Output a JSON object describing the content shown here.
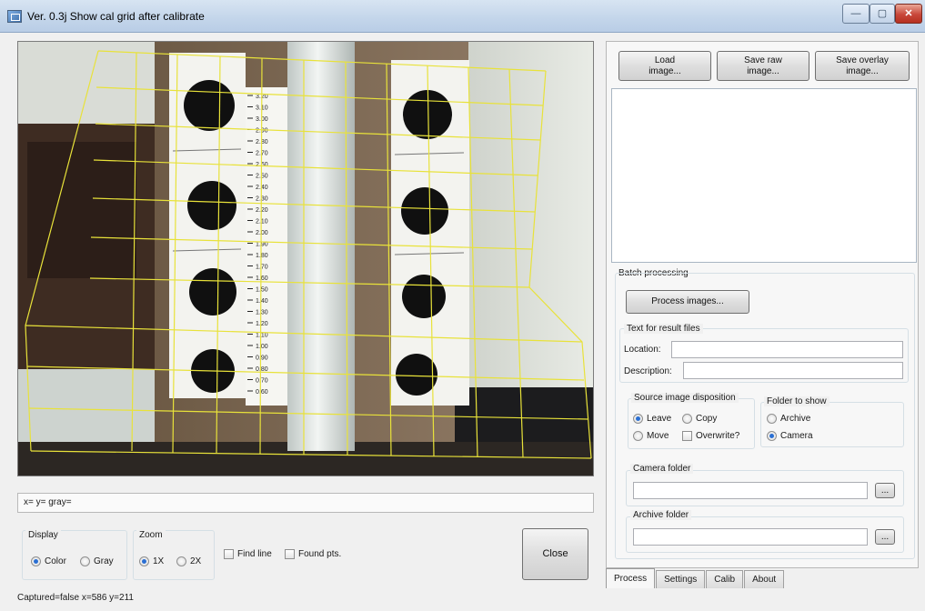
{
  "window": {
    "title": "Ver. 0.3j Show cal grid after calibrate",
    "min_glyph": "—",
    "max_glyph": "▢",
    "close_glyph": "✕"
  },
  "camera": {
    "scale_labels_left": [
      "3.20",
      "3.10",
      "3.00",
      "2.90",
      "2.80",
      "2.70",
      "2.60",
      "2.50",
      "2.40",
      "2.30",
      "2.20",
      "2.10",
      "2.00",
      "1.90",
      "1.80",
      "1.70",
      "1.60",
      "1.50",
      "1.40",
      "1.30",
      "1.20",
      "1.10",
      "1.00",
      "0.90",
      "0.80",
      "0.70",
      "0.60"
    ]
  },
  "readout": {
    "text": "x= y= gray="
  },
  "display": {
    "title": "Display",
    "color_label": "Color",
    "gray_label": "Gray",
    "selected": "Color"
  },
  "zoom": {
    "title": "Zoom",
    "x1_label": "1X",
    "x2_label": "2X",
    "selected": "1X"
  },
  "options": {
    "find_line_label": "Find line",
    "found_pts_label": "Found pts."
  },
  "close_button": {
    "label": "Close"
  },
  "status": {
    "text": "Captured=false x=586 y=211"
  },
  "toolbar": {
    "load_label": "Load\nimage...",
    "save_raw_label": "Save raw\nimage...",
    "save_overlay_label": "Save overlay\nimage..."
  },
  "batch": {
    "title": "Batch processing",
    "process_label": "Process images...",
    "text_group_title": "Text for result files",
    "location_label": "Location:",
    "location_value": "",
    "description_label": "Description:",
    "description_value": ""
  },
  "disposition": {
    "title": "Source image disposition",
    "leave_label": "Leave",
    "copy_label": "Copy",
    "move_label": "Move",
    "overwrite_label": "Overwrite?",
    "selected": "Leave"
  },
  "folder_to_show": {
    "title": "Folder to show",
    "archive_label": "Archive",
    "camera_label": "Camera",
    "selected": "Camera"
  },
  "camera_folder": {
    "title": "Camera folder",
    "value": "",
    "browse_label": "..."
  },
  "archive_folder": {
    "title": "Archive folder",
    "value": "",
    "browse_label": "..."
  },
  "tabs": [
    {
      "label": "Process",
      "active": true
    },
    {
      "label": "Settings",
      "active": false
    },
    {
      "label": "Calib",
      "active": false
    },
    {
      "label": "About",
      "active": false
    }
  ],
  "colors": {
    "grid_line": "#e8e23a",
    "target_dot": "#101010",
    "radio_selected": "#2a6fd3"
  }
}
